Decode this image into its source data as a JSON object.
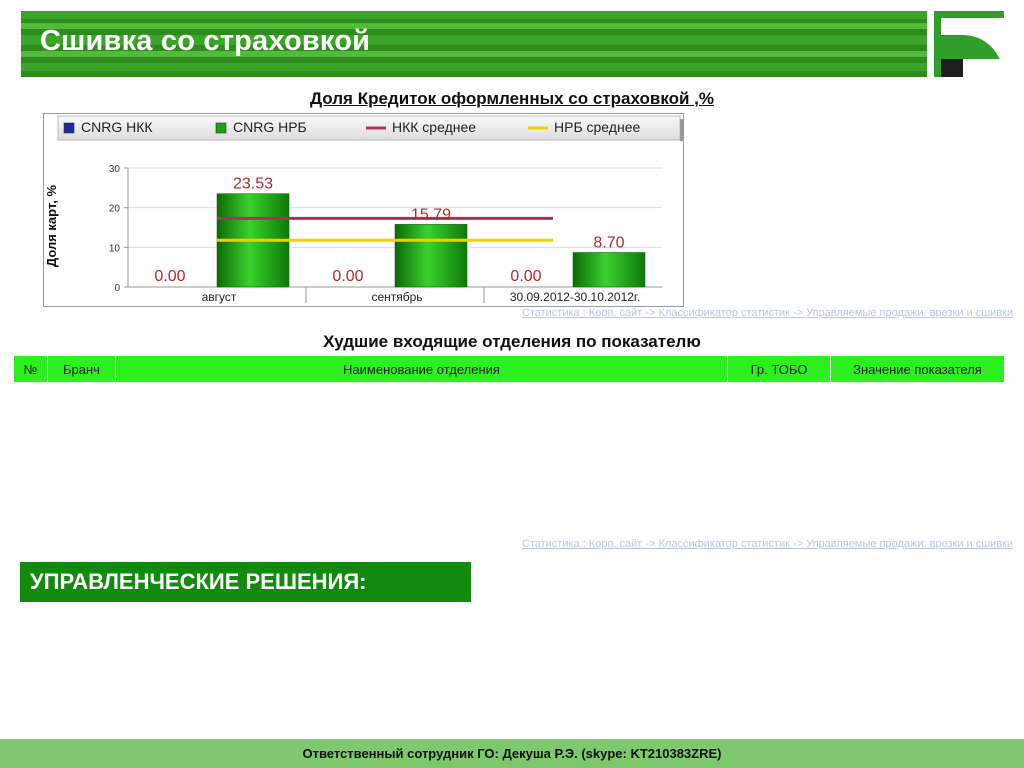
{
  "header": {
    "title": "Сшивка со страховкой"
  },
  "colors": {
    "brand_green": "#2e8b1e",
    "table_header": "#2cf01e",
    "decisions_bg": "#128a10",
    "footer_bg": "#7ec86e",
    "link_color": "#b8c6ea"
  },
  "chart_section": {
    "title": "Доля Кредиток оформленных со страховкой ,%",
    "source_link": "Статистика : Корп. сайт -> Классификатор статистик -> Управляемые продажи: врезки и сшивки"
  },
  "chart_data": {
    "type": "bar",
    "categories": [
      "август",
      "сентябрь",
      "30.09.2012-30.10.2012г."
    ],
    "ylabel": "Доля карт, %",
    "xlabel": "",
    "ylim": [
      0,
      30
    ],
    "yticks": [
      0,
      10,
      20,
      30
    ],
    "grid": true,
    "legend_position": "top",
    "series": [
      {
        "name": "CNRG НКК",
        "type": "bar",
        "color": "#1c2aa0",
        "values": [
          0,
          0,
          0
        ],
        "labels": [
          "0.00",
          "0.00",
          "0.00"
        ]
      },
      {
        "name": "CNRG НРБ",
        "type": "bar",
        "color": "#1aa312",
        "values": [
          23.53,
          15.79,
          8.7
        ],
        "labels": [
          "23.53",
          "15.79",
          "8.70"
        ]
      },
      {
        "name": "НКК среднее",
        "type": "line",
        "color": "#a8325a",
        "value": 17.3
      },
      {
        "name": "НРБ среднее",
        "type": "line",
        "color": "#f0d000",
        "value": 11.8
      }
    ]
  },
  "worst_section": {
    "title": "Худшие входящие отделения по показателю",
    "columns": [
      "№",
      "Бранч",
      "Наименование отделения",
      "Гр. ТОБО",
      "Значение показателя"
    ],
    "rows": [],
    "source_link": "Статистика : Корп. сайт -> Классификатор статистик -> Управляемые продажи: врезки и сшивки"
  },
  "decisions": {
    "title": "УПРАВЛЕНЧЕСКИЕ РЕШЕНИЯ:"
  },
  "footer": {
    "text": "Ответственный сотрудник ГО: Декуша Р.Э. (skype: KT210383ZRE)"
  }
}
